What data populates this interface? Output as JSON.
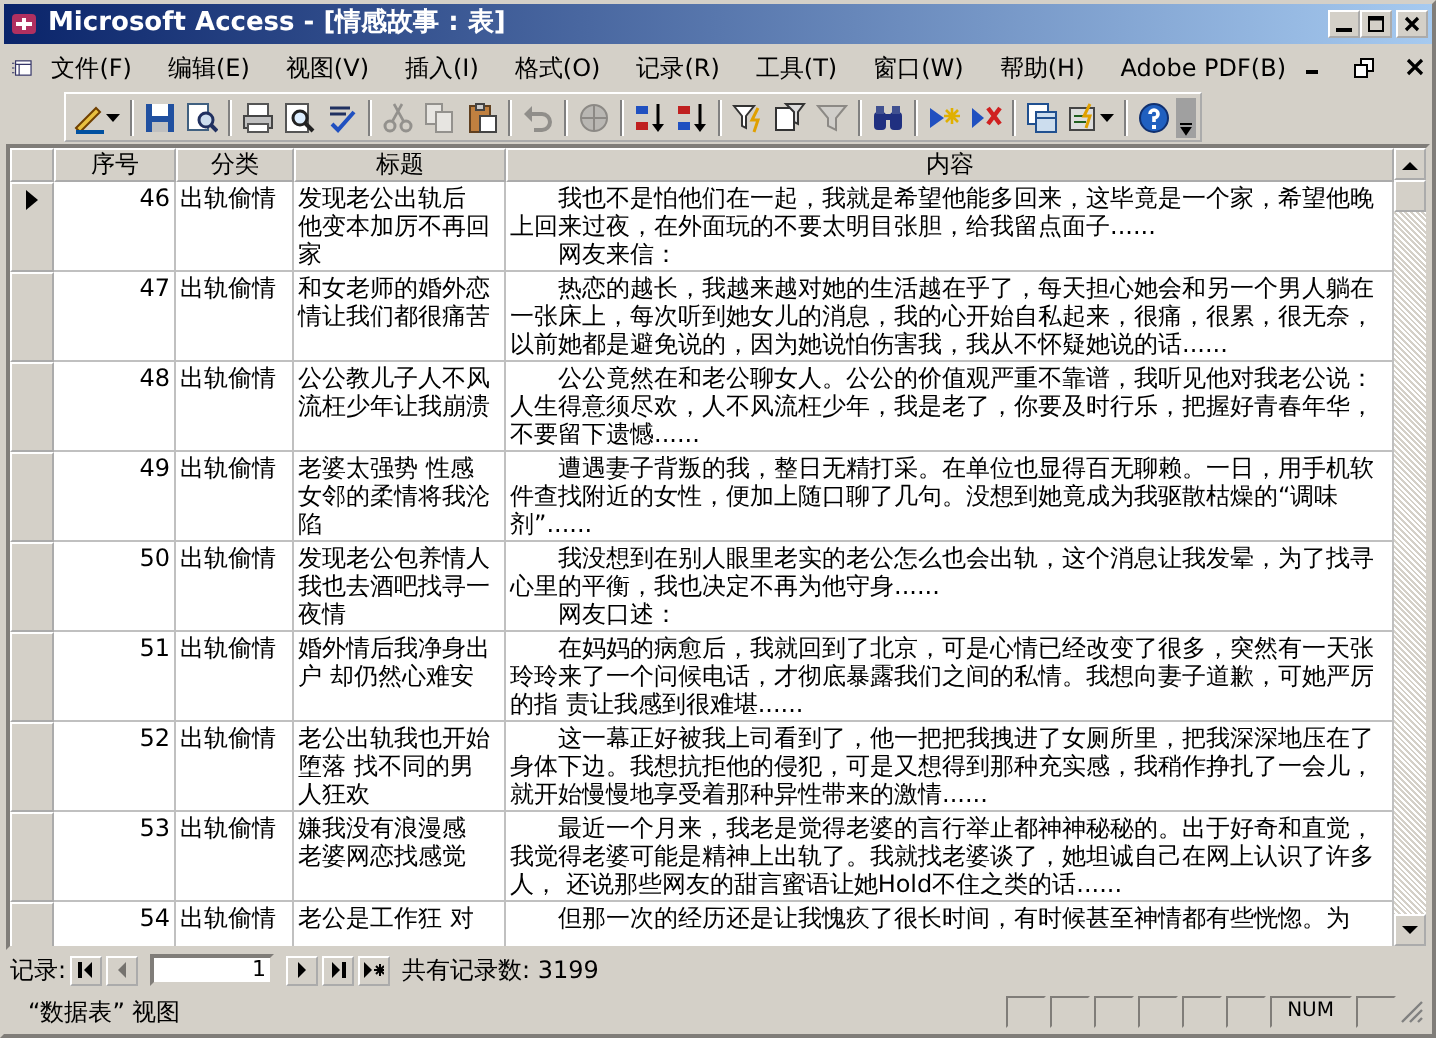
{
  "window": {
    "title": "Microsoft Access - [情感故事 : 表]"
  },
  "menu": [
    "文件(F)",
    "编辑(E)",
    "视图(V)",
    "插入(I)",
    "格式(O)",
    "记录(R)",
    "工具(T)",
    "窗口(W)",
    "帮助(H)",
    "Adobe PDF(B)"
  ],
  "toolbar": [
    {
      "kind": "design",
      "disabled": false
    },
    {
      "kind": "sep"
    },
    {
      "kind": "save",
      "disabled": false
    },
    {
      "kind": "search-doc",
      "disabled": false
    },
    {
      "kind": "sep"
    },
    {
      "kind": "print",
      "disabled": false
    },
    {
      "kind": "preview",
      "disabled": false
    },
    {
      "kind": "spell",
      "disabled": false
    },
    {
      "kind": "sep"
    },
    {
      "kind": "cut",
      "disabled": true
    },
    {
      "kind": "copy",
      "disabled": true
    },
    {
      "kind": "paste",
      "disabled": false
    },
    {
      "kind": "sep"
    },
    {
      "kind": "undo",
      "disabled": true
    },
    {
      "kind": "sep"
    },
    {
      "kind": "links",
      "disabled": true
    },
    {
      "kind": "sep"
    },
    {
      "kind": "sort-asc",
      "disabled": false
    },
    {
      "kind": "sort-desc",
      "disabled": false
    },
    {
      "kind": "sep"
    },
    {
      "kind": "filter-sel",
      "disabled": false
    },
    {
      "kind": "filter-form",
      "disabled": false
    },
    {
      "kind": "filter",
      "disabled": true
    },
    {
      "kind": "sep"
    },
    {
      "kind": "find",
      "disabled": false
    },
    {
      "kind": "sep"
    },
    {
      "kind": "new-record",
      "disabled": false
    },
    {
      "kind": "delete-record",
      "disabled": false
    },
    {
      "kind": "sep"
    },
    {
      "kind": "db-window",
      "disabled": false
    },
    {
      "kind": "new-object",
      "disabled": false
    },
    {
      "kind": "sep"
    },
    {
      "kind": "help",
      "disabled": false
    }
  ],
  "table": {
    "columns": [
      "序号",
      "分类",
      "标题",
      "内容"
    ],
    "rows": [
      {
        "selected": true,
        "id": "46",
        "category": "出轨偷情",
        "title": [
          "发现老公出轨后",
          "他变本加厉不再回家"
        ],
        "content": [
          "我也不是怕他们在一起，我就是希望他能多回来，这毕竟是一个家，希望他晚上回来过夜，在外面玩的不要太明目张胆，给我留点面子......",
          "网友来信："
        ]
      },
      {
        "selected": false,
        "id": "47",
        "category": "出轨偷情",
        "title": [
          "和女老师的婚外恋情让我们都很痛苦"
        ],
        "content": [
          "热恋的越长，我越来越对她的生活越在乎了，每天担心她会和另一个男人躺在一张床上，每次听到她女儿的消息，我的心开始自私起来，很痛，很累，很无奈，以前她都是避免说的，因为她说怕伤害我，我从不怀疑她说的话......"
        ]
      },
      {
        "selected": false,
        "id": "48",
        "category": "出轨偷情",
        "title": [
          "公公教儿子人不风流枉少年让我崩溃"
        ],
        "content": [
          "公公竟然在和老公聊女人。公公的价值观严重不靠谱，我听见他对我老公说：人生得意须尽欢，人不风流枉少年，我是老了，你要及时行乐，把握好青春年华，不要留下遗憾......"
        ]
      },
      {
        "selected": false,
        "id": "49",
        "category": "出轨偷情",
        "title": [
          "老婆太强势 性感女邻的柔情将我沦陷"
        ],
        "content": [
          "遭遇妻子背叛的我，整日无精打采。在单位也显得百无聊赖。一日，用手机软件查找附近的女性，便加上随口聊了几句。没想到她竟成为我驱散枯燥的“调味剂”......"
        ]
      },
      {
        "selected": false,
        "id": "50",
        "category": "出轨偷情",
        "title": [
          "发现老公包养情人",
          "我也去酒吧找寻一夜情"
        ],
        "content": [
          "我没想到在别人眼里老实的老公怎么也会出轨，这个消息让我发晕，为了找寻心里的平衡，我也决定不再为他守身......",
          "网友口述："
        ]
      },
      {
        "selected": false,
        "id": "51",
        "category": "出轨偷情",
        "title": [
          "婚外情后我净身出户 却仍然心难安"
        ],
        "content": [
          "在妈妈的病愈后，我就回到了北京，可是心情已经改变了很多，突然有一天张玲玲来了一个问候电话，才彻底暴露我们之间的私情。我想向妻子道歉，可她严厉的指 责让我感到很难堪......"
        ]
      },
      {
        "selected": false,
        "id": "52",
        "category": "出轨偷情",
        "title": [
          "老公出轨我也开始堕落 找不同的男人狂欢"
        ],
        "content": [
          "这一幕正好被我上司看到了，他一把把我拽进了女厕所里，把我深深地压在了身体下边。我想抗拒他的侵犯，可是又想得到那种充实感，我稍作挣扎了一会儿，就开始慢慢地享受着那种异性带来的激情......"
        ]
      },
      {
        "selected": false,
        "id": "53",
        "category": "出轨偷情",
        "title": [
          "嫌我没有浪漫感",
          "老婆网恋找感觉"
        ],
        "content": [
          "最近一个月来，我老是觉得老婆的言行举止都神神秘秘的。出于好奇和直觉，我觉得老婆可能是精神上出轨了。我就找老婆谈了，她坦诚自己在网上认识了许多人， 还说那些网友的甜言蜜语让她Hold不住之类的话......"
        ]
      },
      {
        "selected": false,
        "id": "54",
        "category": "出轨偷情",
        "title": [
          "老公是工作狂 对"
        ],
        "content": [
          "但那一次的经历还是让我愧疚了很长时间，有时候甚至神情都有些恍惚。为"
        ]
      }
    ]
  },
  "record_nav": {
    "label": "记录:",
    "current": "1",
    "first_disabled": false,
    "prev_disabled": true,
    "total": "共有记录数: 3199"
  },
  "status_bar": {
    "view": "“数据表” 视图",
    "indicator": "NUM"
  }
}
